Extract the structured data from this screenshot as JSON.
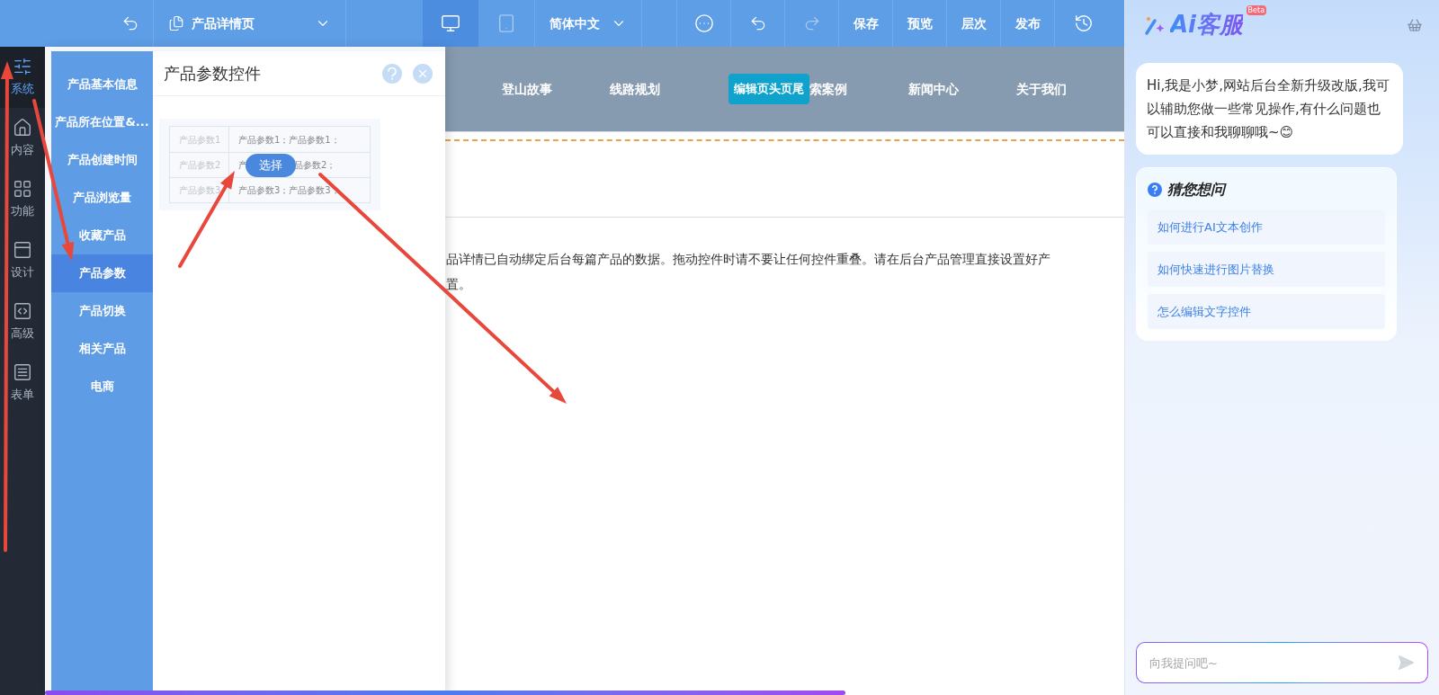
{
  "toolbar": {
    "page_selector": {
      "label": "产品详情页"
    },
    "devices": [
      {
        "kind": "desktop",
        "selected": true
      },
      {
        "kind": "tablet",
        "selected": false
      }
    ],
    "language": {
      "label": "简体中文"
    },
    "actions": [
      {
        "kind": "more"
      },
      {
        "kind": "undo",
        "disabled": false
      },
      {
        "kind": "redo",
        "disabled": true
      },
      {
        "kind": "text",
        "label": "保存"
      },
      {
        "kind": "text",
        "label": "预览"
      },
      {
        "kind": "text",
        "label": "层次"
      },
      {
        "kind": "text",
        "label": "发布"
      },
      {
        "kind": "history"
      }
    ]
  },
  "sidebar": {
    "items": [
      {
        "label": "系统",
        "selected": true
      },
      {
        "label": "内容",
        "selected": false
      },
      {
        "label": "功能",
        "selected": false
      },
      {
        "label": "设计",
        "selected": false
      },
      {
        "label": "高级",
        "selected": false
      },
      {
        "label": "表单",
        "selected": false
      }
    ]
  },
  "submenu": {
    "items": [
      {
        "label": "产品基本信息",
        "selected": false
      },
      {
        "label": "产品所在位置&...",
        "selected": false
      },
      {
        "label": "产品创建时间",
        "selected": false
      },
      {
        "label": "产品浏览量",
        "selected": false
      },
      {
        "label": "收藏产品",
        "selected": false
      },
      {
        "label": "产品参数",
        "selected": true
      },
      {
        "label": "产品切换",
        "selected": false
      },
      {
        "label": "相关产品",
        "selected": false
      },
      {
        "label": "电商",
        "selected": false
      }
    ]
  },
  "widget_panel": {
    "title": "产品参数控件",
    "preview_rows": [
      {
        "label": "产品参数1",
        "value_parts": [
          "产品参数1；产品参数1；"
        ]
      },
      {
        "label": "产品参数2",
        "value_parts": [
          "产",
          "品参数2；"
        ]
      },
      {
        "label": "产品参数3",
        "value_parts": [
          "产品参数3；产品参数3；"
        ]
      }
    ],
    "select_button": {
      "label": "选择"
    }
  },
  "canvas": {
    "nav_items": [
      {
        "kind": "link",
        "label": "登山故事"
      },
      {
        "kind": "link",
        "label": "线路规划"
      },
      {
        "kind": "badge",
        "label": "编辑页头页尾"
      },
      {
        "kind": "link",
        "label": "索案例"
      },
      {
        "kind": "link",
        "label": "新闻中心"
      },
      {
        "kind": "link",
        "label": "关于我们"
      }
    ],
    "body_lines": [
      "品详情已自动绑定后台每篇产品的数据。拖动控件时请不要让任何控件重叠。请在后台产品管理直接设置好产",
      "置。"
    ]
  },
  "assistant": {
    "title": "Ai客服",
    "badge": "Beta",
    "greeting": "Hi,我是小梦,网站后台全新升级改版,我可以辅助您做一些常见操作,有什么问题也可以直接和我聊聊哦~😊",
    "suggestions": {
      "title": "猜您想问",
      "items": [
        "如何进行AI文本创作",
        "如何快速进行图片替换",
        "怎么编辑文字控件"
      ]
    },
    "input": {
      "placeholder": "向我提问吧~"
    }
  }
}
